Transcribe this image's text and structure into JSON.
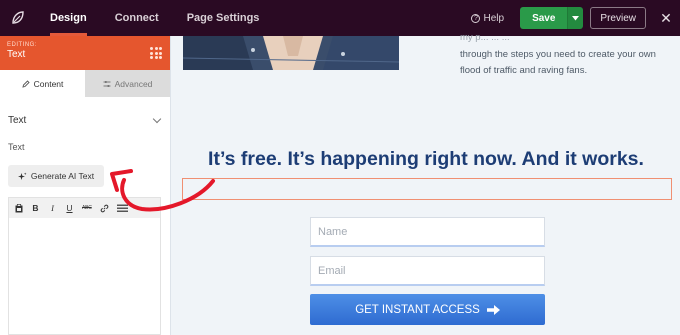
{
  "topbar": {
    "tabs": [
      {
        "label": "Design",
        "active": true
      },
      {
        "label": "Connect",
        "active": false
      },
      {
        "label": "Page Settings",
        "active": false
      }
    ],
    "help_label": "Help",
    "save_label": "Save",
    "preview_label": "Preview",
    "icons": {
      "logo": "seedprod-leaf-icon",
      "help": "help-circle-icon",
      "save_dropdown": "caret-down-icon",
      "close": "close-icon"
    }
  },
  "sidebar": {
    "editing_label": "EDITING:",
    "editing_title": "Text",
    "tabs": [
      {
        "label": "Content",
        "active": true,
        "icon": "pencil-icon"
      },
      {
        "label": "Advanced",
        "active": false,
        "icon": "sliders-icon"
      }
    ],
    "section_title": "Text",
    "field_label": "Text",
    "ai_button_label": "Generate AI Text",
    "toolbar_icons": [
      "clipboard-icon",
      "bold-icon",
      "italic-icon",
      "underline-icon",
      "strikethrough-icon",
      "link-icon",
      "toolbar-toggle-icon"
    ],
    "toolbar_labels": {
      "bold": "B",
      "italic": "I",
      "underline": "U",
      "strike": "ABC"
    }
  },
  "canvas": {
    "hero_copy_line1": "my p... ... ...",
    "hero_copy_line2": "through the steps you need to create your own",
    "hero_copy_line3": "flood of traffic and raving fans.",
    "headline": "It’s free. It’s happening right now. And it works.",
    "form": {
      "name_placeholder": "Name",
      "email_placeholder": "Email",
      "cta_label": "GET INSTANT ACCESS"
    }
  },
  "colors": {
    "topbar_bg": "#2a0a23",
    "accent_orange": "#e5562e",
    "save_green": "#2a9a49",
    "headline_navy": "#1d3d75",
    "cta_blue": "#3b7be0",
    "annotation_red": "#e4182a"
  }
}
